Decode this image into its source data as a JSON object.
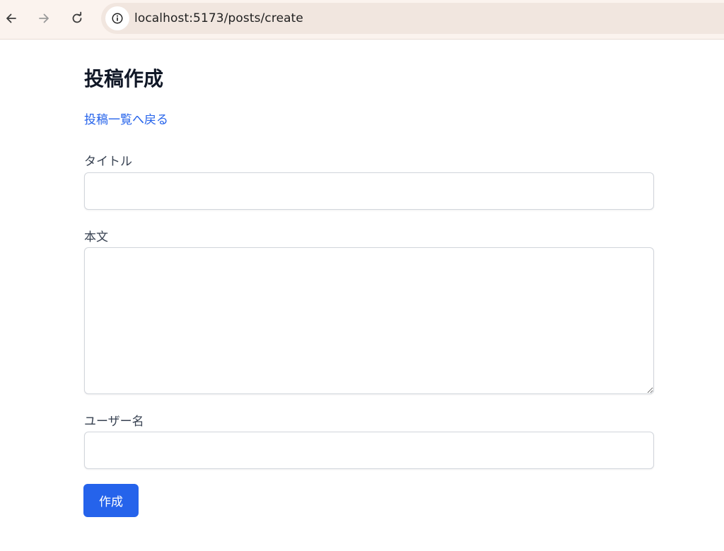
{
  "browser": {
    "url": "localhost:5173/posts/create",
    "icons": {
      "back": "arrow-left-icon",
      "forward": "arrow-right-icon",
      "reload": "reload-icon",
      "site_info": "info-icon"
    }
  },
  "page": {
    "title": "投稿作成",
    "back_link": "投稿一覧へ戻る"
  },
  "form": {
    "title_label": "タイトル",
    "title_value": "",
    "body_label": "本文",
    "body_value": "",
    "username_label": "ユーザー名",
    "username_value": "",
    "submit_label": "作成"
  },
  "colors": {
    "accent": "#2563eb",
    "heading": "#111827",
    "label": "#374151",
    "chrome_bg": "#fbf3ee"
  }
}
